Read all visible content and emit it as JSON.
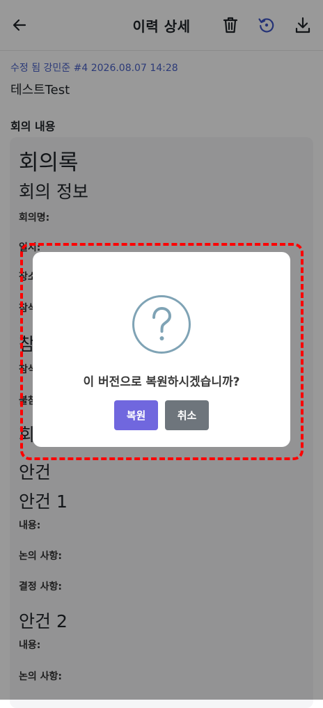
{
  "header": {
    "title": "이력 상세",
    "back_icon": "arrow-left-icon",
    "trash_icon": "trash-icon",
    "restore_icon": "history-restore-icon",
    "download_icon": "download-icon"
  },
  "meta": {
    "line": "수정 됨 강민준 #4 2026.08.07 14:28",
    "title": "테스트Test"
  },
  "section": {
    "label": "회의 내용"
  },
  "content": {
    "h_minutes": "회의록",
    "h_info": "회의 정보",
    "meeting_name_label": "회의명:",
    "date_label_partial": "일시:",
    "place_label_partial": "장소:",
    "attendees_label_partial": "참석",
    "h_attendees_partial": "참",
    "attendee_label_partial": "참석",
    "absent_label_partial": "불참",
    "h_meeting_partial": "회",
    "h_agenda": "안건",
    "h_agenda1": "안건 1",
    "agenda1_content_label": "내용:",
    "agenda1_discussion_label": "논의 사항:",
    "agenda1_decision_label": "결정 사항:",
    "h_agenda2": "안건 2",
    "agenda2_content_label": "내용:",
    "agenda2_discussion_label": "논의 사항:"
  },
  "dialog": {
    "icon": "question-circle-icon",
    "message": "이 버전으로 복원하시겠습니까?",
    "confirm_label": "복원",
    "cancel_label": "취소"
  },
  "colors": {
    "accent": "#4a62c9",
    "confirm_button": "#7067de",
    "cancel_button": "#6e757c",
    "highlight_border": "#ff0000",
    "question_icon": "#7fa3b5"
  }
}
